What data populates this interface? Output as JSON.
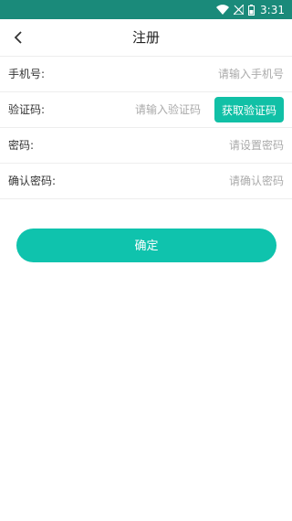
{
  "status_bar": {
    "time": "3:31",
    "icons": [
      "wifi-icon",
      "no-signal-icon",
      "battery-icon"
    ]
  },
  "header": {
    "title": "注册",
    "back_icon": "chevron-left-icon"
  },
  "form": {
    "phone": {
      "label": "手机号:",
      "placeholder": "请输入手机号",
      "value": ""
    },
    "code": {
      "label": "验证码:",
      "placeholder": "请输入验证码",
      "value": "",
      "button_label": "获取验证码"
    },
    "password": {
      "label": "密码:",
      "placeholder": "请设置密码",
      "value": ""
    },
    "confirm_password": {
      "label": "确认密码:",
      "placeholder": "请确认密码",
      "value": ""
    }
  },
  "confirm_button": {
    "label": "确定"
  },
  "colors": {
    "status_bar": "#1a8a7a",
    "accent": "#0fc3ad",
    "code_button": "#11c0a6",
    "placeholder": "#aaaaaa",
    "divider": "#eeeeee"
  }
}
